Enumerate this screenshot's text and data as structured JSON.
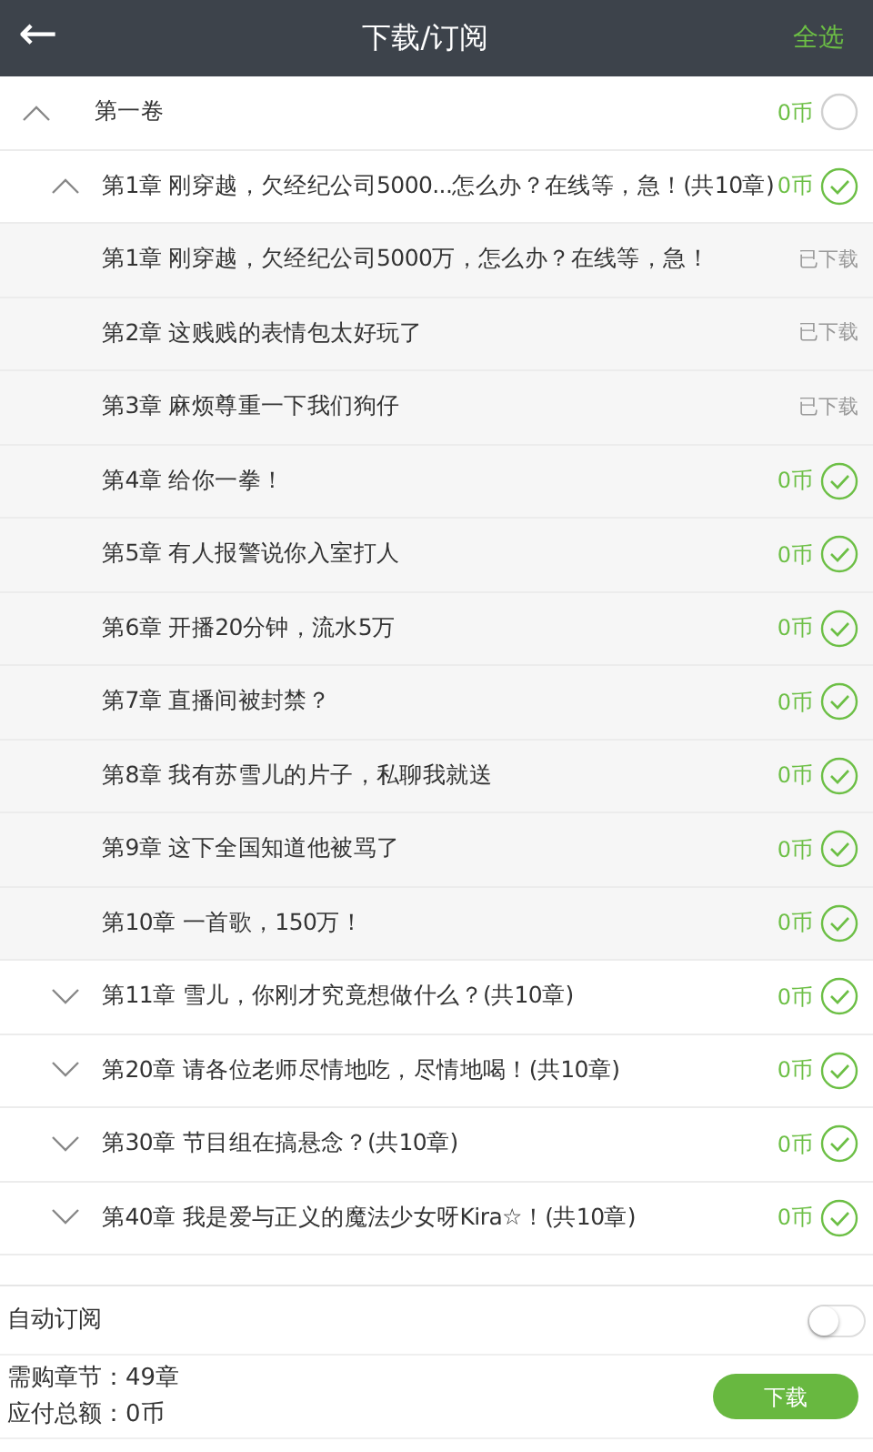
{
  "header": {
    "back": "←",
    "title": "下载/订阅",
    "select_all": "全选"
  },
  "volumes": [
    {
      "title": "第一卷",
      "price": "0币",
      "checked": false,
      "expanded": true,
      "groups": [
        {
          "title": "第1章 刚穿越，欠经纪公司5000...怎么办？在线等，急！(共10章)",
          "price": "0币",
          "checked": true,
          "expanded": true,
          "children": [
            {
              "kind": "downloaded",
              "title": "第1章 刚穿越，欠经纪公司5000万，怎么办？在线等，急！",
              "status": "已下载"
            },
            {
              "kind": "downloaded",
              "title": "第2章 这贱贱的表情包太好玩了",
              "status": "已下载"
            },
            {
              "kind": "downloaded",
              "title": "第3章 麻烦尊重一下我们狗仔",
              "status": "已下载"
            },
            {
              "kind": "purchasable",
              "title": "第4章 给你一拳！",
              "price": "0币",
              "checked": true
            },
            {
              "kind": "purchasable",
              "title": "第5章 有人报警说你入室打人",
              "price": "0币",
              "checked": true
            },
            {
              "kind": "purchasable",
              "title": "第6章 开播20分钟，流水5万",
              "price": "0币",
              "checked": true
            },
            {
              "kind": "purchasable",
              "title": "第7章 直播间被封禁？",
              "price": "0币",
              "checked": true
            },
            {
              "kind": "purchasable",
              "title": "第8章 我有苏雪儿的片子，私聊我就送",
              "price": "0币",
              "checked": true
            },
            {
              "kind": "purchasable",
              "title": "第9章 这下全国知道他被骂了",
              "price": "0币",
              "checked": true
            },
            {
              "kind": "purchasable",
              "title": "第10章 一首歌，150万！",
              "price": "0币",
              "checked": true
            }
          ]
        },
        {
          "title": "第11章 雪儿，你刚才究竟想做什么？(共10章)",
          "price": "0币",
          "checked": true,
          "expanded": false
        },
        {
          "title": "第20章 请各位老师尽情地吃，尽情地喝！(共10章)",
          "price": "0币",
          "checked": true,
          "expanded": false
        },
        {
          "title": "第30章 节目组在搞悬念？(共10章)",
          "price": "0币",
          "checked": true,
          "expanded": false
        },
        {
          "title": "第40章 我是爱与正义的魔法少女呀Kira☆！(共10章)",
          "price": "0币",
          "checked": true,
          "expanded": false
        }
      ]
    }
  ],
  "auto_subscribe": {
    "label": "自动订阅",
    "on": false
  },
  "summary": {
    "chapters": "需购章节：49章",
    "total": "应付总额：0币"
  },
  "download_button": "下载"
}
